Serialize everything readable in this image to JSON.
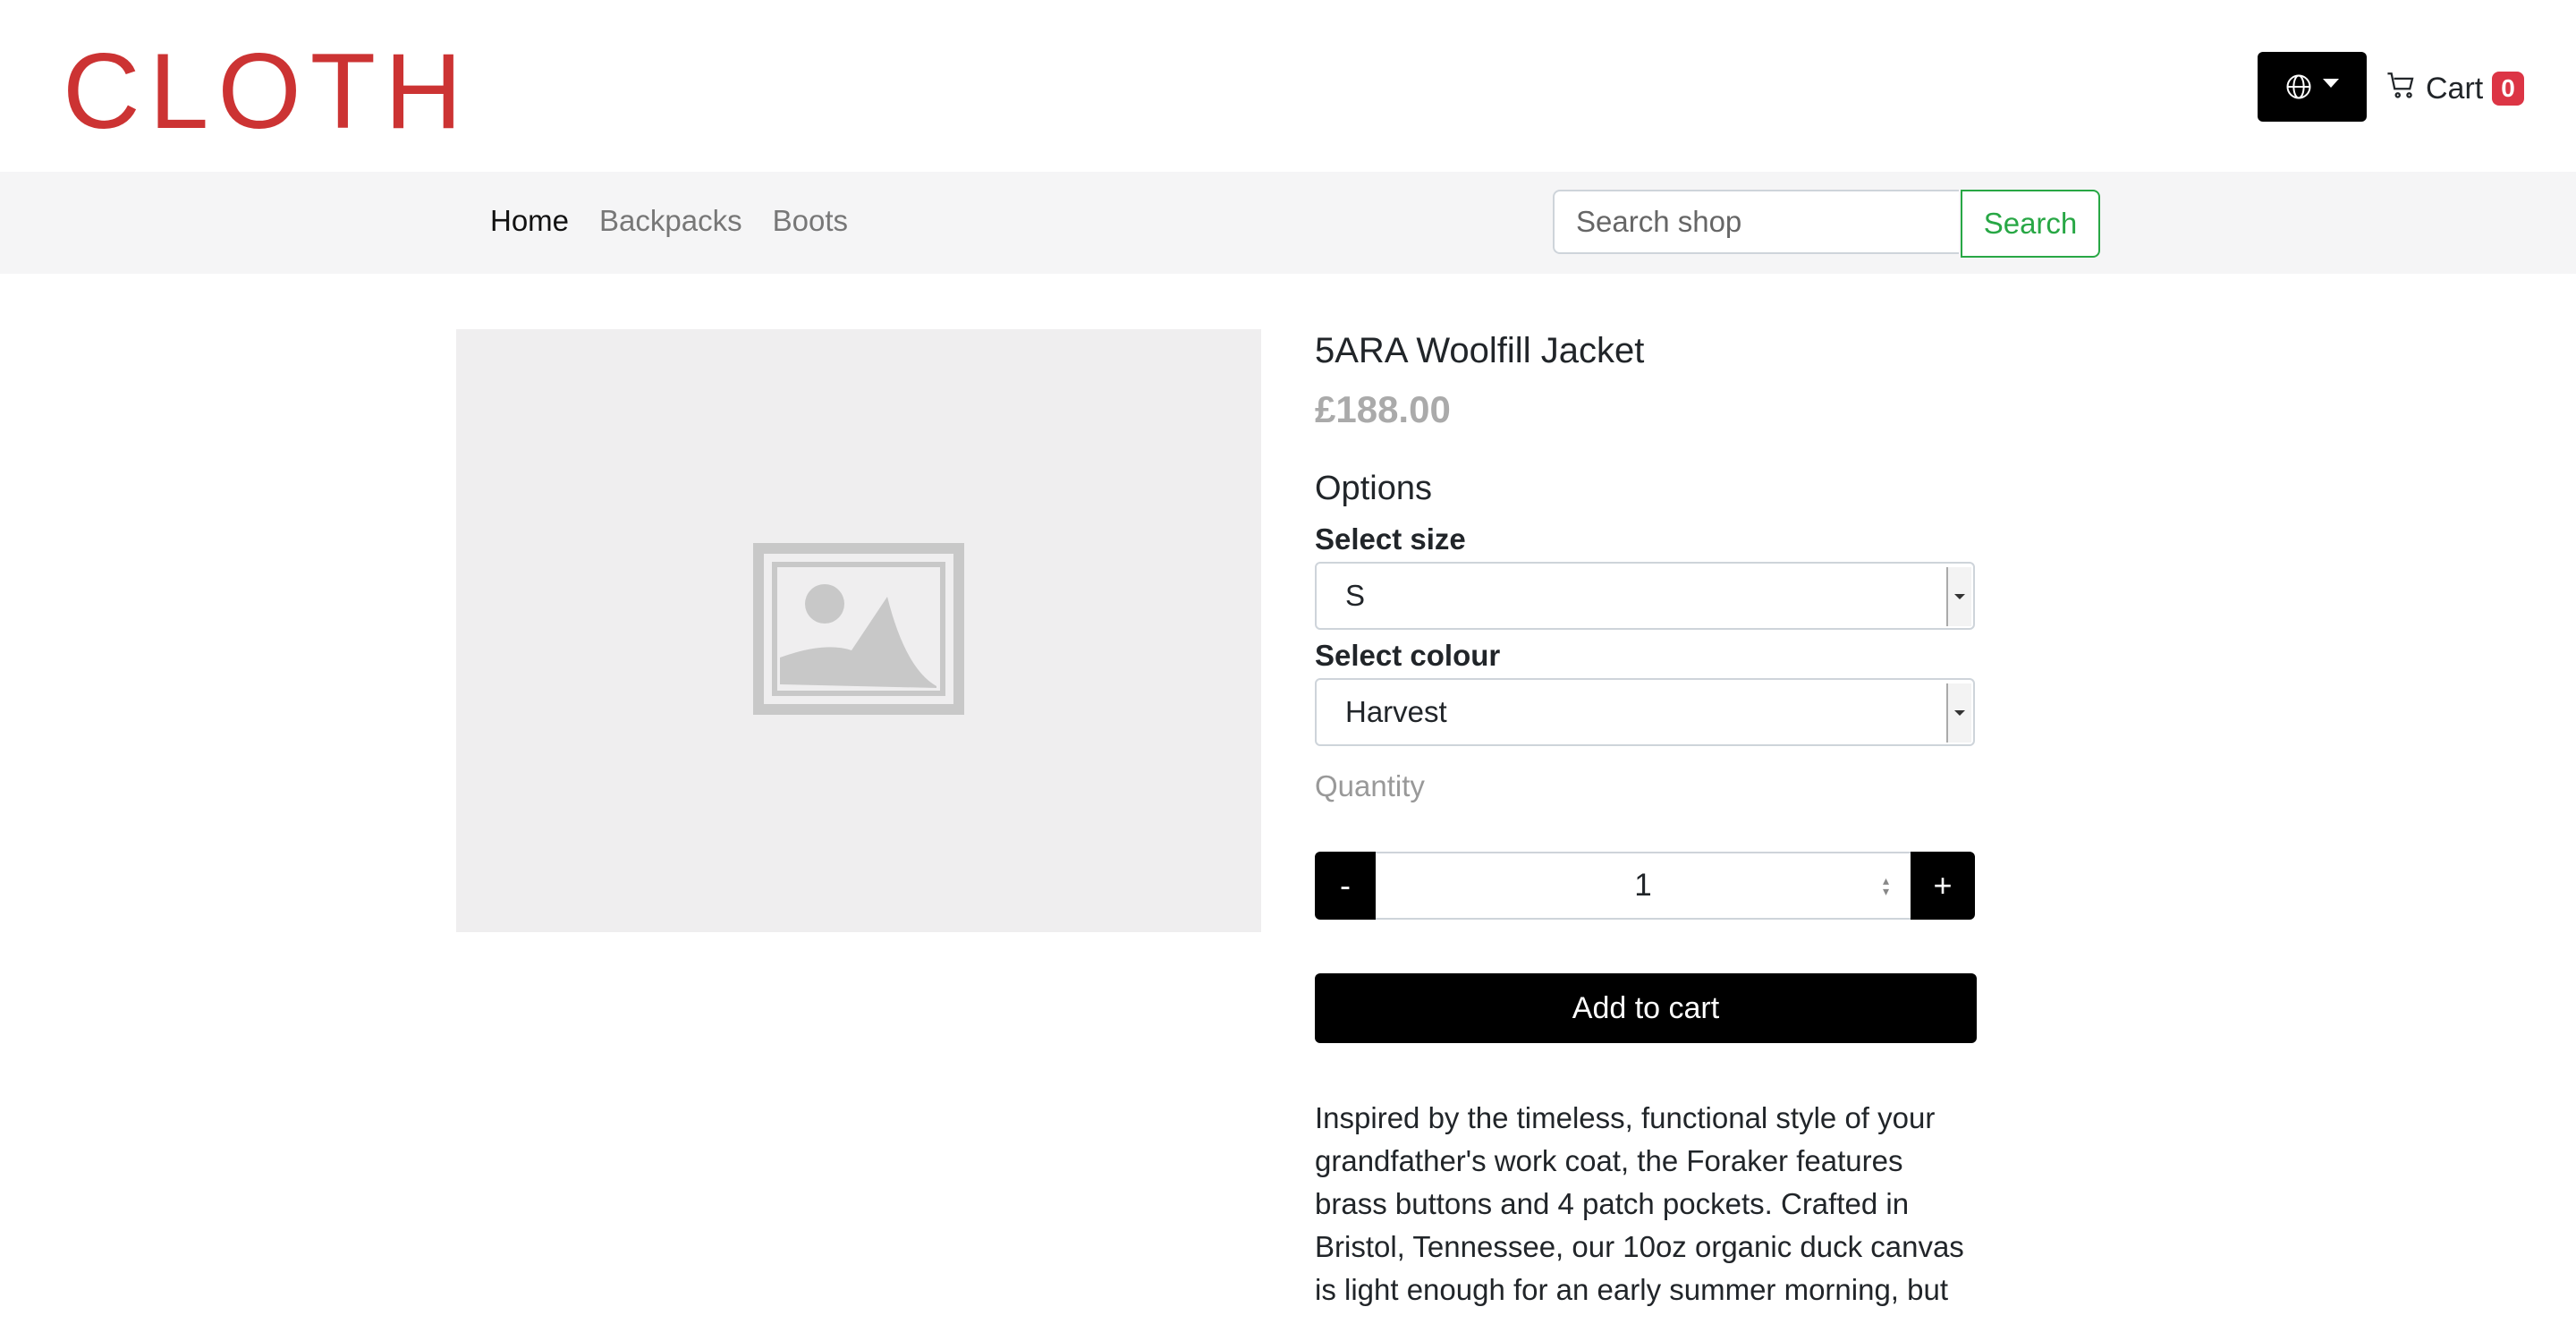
{
  "header": {
    "logo": "CLOTH",
    "language_icon": "globe-icon",
    "cart_label": "Cart",
    "cart_count": "0",
    "cart_icon": "cart-icon"
  },
  "nav": {
    "links": [
      {
        "label": "Home",
        "active": true
      },
      {
        "label": "Backpacks",
        "active": false
      },
      {
        "label": "Boots",
        "active": false
      }
    ],
    "search_placeholder": "Search shop",
    "search_button": "Search"
  },
  "product": {
    "image_icon": "image-placeholder-icon",
    "title": "5ARA Woolfill Jacket",
    "price": "£188.00",
    "options_heading": "Options",
    "size_label": "Select size",
    "size_value": "S",
    "colour_label": "Select colour",
    "colour_value": "Harvest",
    "quantity_label": "Quantity",
    "quantity_minus": "-",
    "quantity_value": "1",
    "quantity_plus": "+",
    "add_to_cart": "Add to cart",
    "description": "Inspired by the timeless, functional style of your grandfather's work coat, the Foraker features brass buttons and 4 patch pockets. Crafted in Bristol, Tennessee, our 10oz organic duck canvas is light enough for an early summer morning, but"
  },
  "colors": {
    "logo": "#cc3333",
    "search_accent": "#28a745",
    "cart_badge": "#dc3545"
  }
}
